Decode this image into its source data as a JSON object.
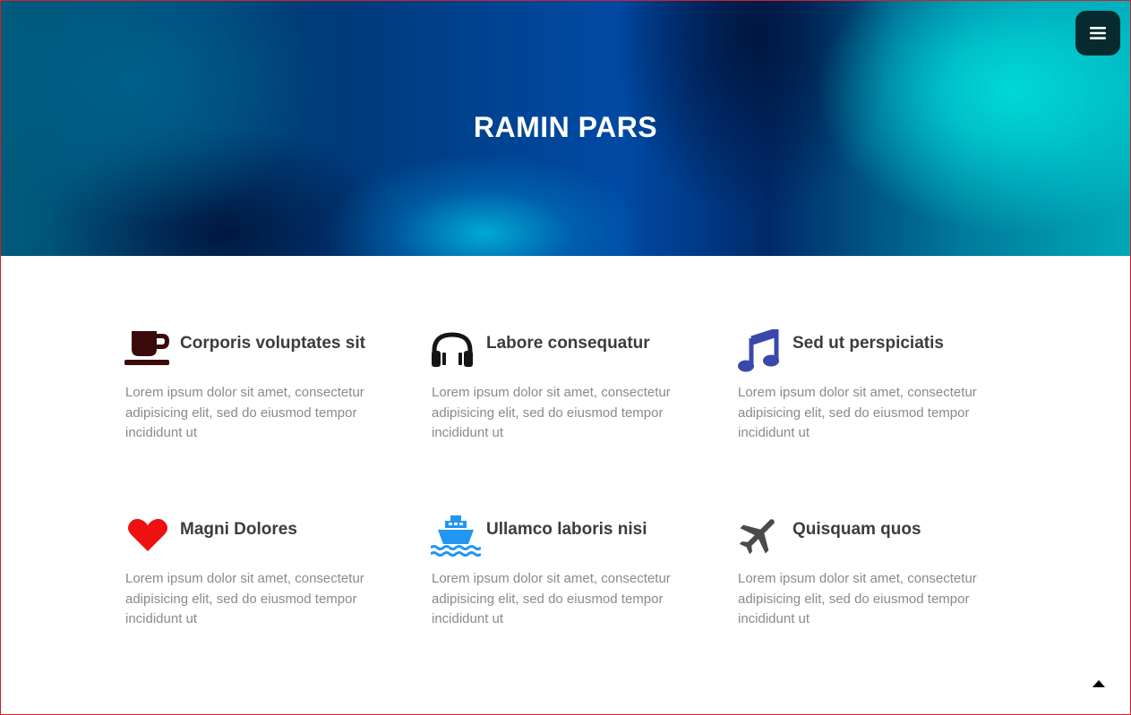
{
  "header": {
    "title": "RAMIN PARS",
    "menu_icon": "hamburger-menu-icon"
  },
  "features": [
    {
      "icon": "coffee-cup-icon",
      "icon_color": "#3b0a0a",
      "title": "Corporis voluptates sit",
      "text": "Lorem ipsum dolor sit amet, consectetur adipisicing elit, sed do eiusmod tempor incididunt ut"
    },
    {
      "icon": "headphones-icon",
      "icon_color": "#151515",
      "title": "Labore consequatur",
      "text": "Lorem ipsum dolor sit amet, consectetur adipisicing elit, sed do eiusmod tempor incididunt ut"
    },
    {
      "icon": "music-note-icon",
      "icon_color": "#3949ab",
      "title": "Sed ut perspiciatis",
      "text": "Lorem ipsum dolor sit amet, consectetur adipisicing elit, sed do eiusmod tempor incididunt ut"
    },
    {
      "icon": "heart-icon",
      "icon_color": "#ee1111",
      "title": "Magni Dolores",
      "text": "Lorem ipsum dolor sit amet, consectetur adipisicing elit, sed do eiusmod tempor incididunt ut"
    },
    {
      "icon": "ship-icon",
      "icon_color": "#2196f3",
      "title": "Ullamco laboris nisi",
      "text": "Lorem ipsum dolor sit amet, consectetur adipisicing elit, sed do eiusmod tempor incididunt ut"
    },
    {
      "icon": "airplane-icon",
      "icon_color": "#4a4a4a",
      "title": "Quisquam quos",
      "text": "Lorem ipsum dolor sit amet, consectetur adipisicing elit, sed do eiusmod tempor incididunt ut"
    }
  ],
  "scroll_top_icon": "caret-up-icon"
}
